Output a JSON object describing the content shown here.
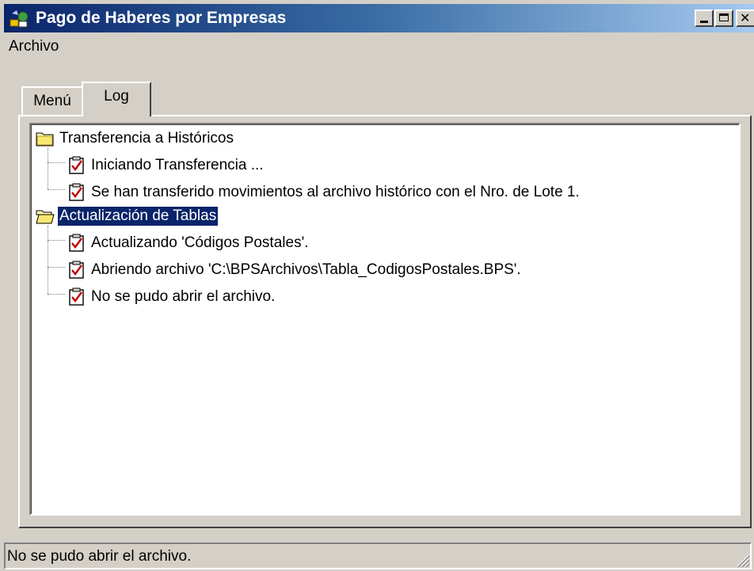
{
  "window": {
    "title": "Pago de Haberes por Empresas",
    "controls": {
      "minimize": "minimize",
      "maximize": "maximize",
      "close": "close"
    }
  },
  "menubar": {
    "items": [
      {
        "label": "Archivo"
      }
    ]
  },
  "tabs": [
    {
      "label": "Menú",
      "active": false
    },
    {
      "label": "Log",
      "active": true
    }
  ],
  "tree": {
    "groups": [
      {
        "label": "Transferencia a Históricos",
        "icon": "folder-closed-icon",
        "selected": false,
        "items": [
          {
            "label": "Iniciando Transferencia ...",
            "icon": "checked-clipboard-icon"
          },
          {
            "label": "Se han transferido movimientos al archivo histórico con el Nro. de Lote 1.",
            "icon": "checked-clipboard-icon"
          }
        ]
      },
      {
        "label": "Actualización de Tablas",
        "icon": "folder-open-icon",
        "selected": true,
        "items": [
          {
            "label": "Actualizando 'Códigos Postales'.",
            "icon": "checked-clipboard-icon"
          },
          {
            "label": "Abriendo archivo 'C:\\BPSArchivos\\Tabla_CodigosPostales.BPS'.",
            "icon": "checked-clipboard-icon"
          },
          {
            "label": "No se pudo abrir el archivo.",
            "icon": "checked-clipboard-icon"
          }
        ]
      }
    ]
  },
  "statusbar": {
    "text": "No se pudo abrir el archivo."
  },
  "colors": {
    "titlebar_start": "#0a246a",
    "titlebar_end": "#a6caf0",
    "face": "#d4d0c8",
    "selection": "#0a246a",
    "check": "#c00000"
  }
}
